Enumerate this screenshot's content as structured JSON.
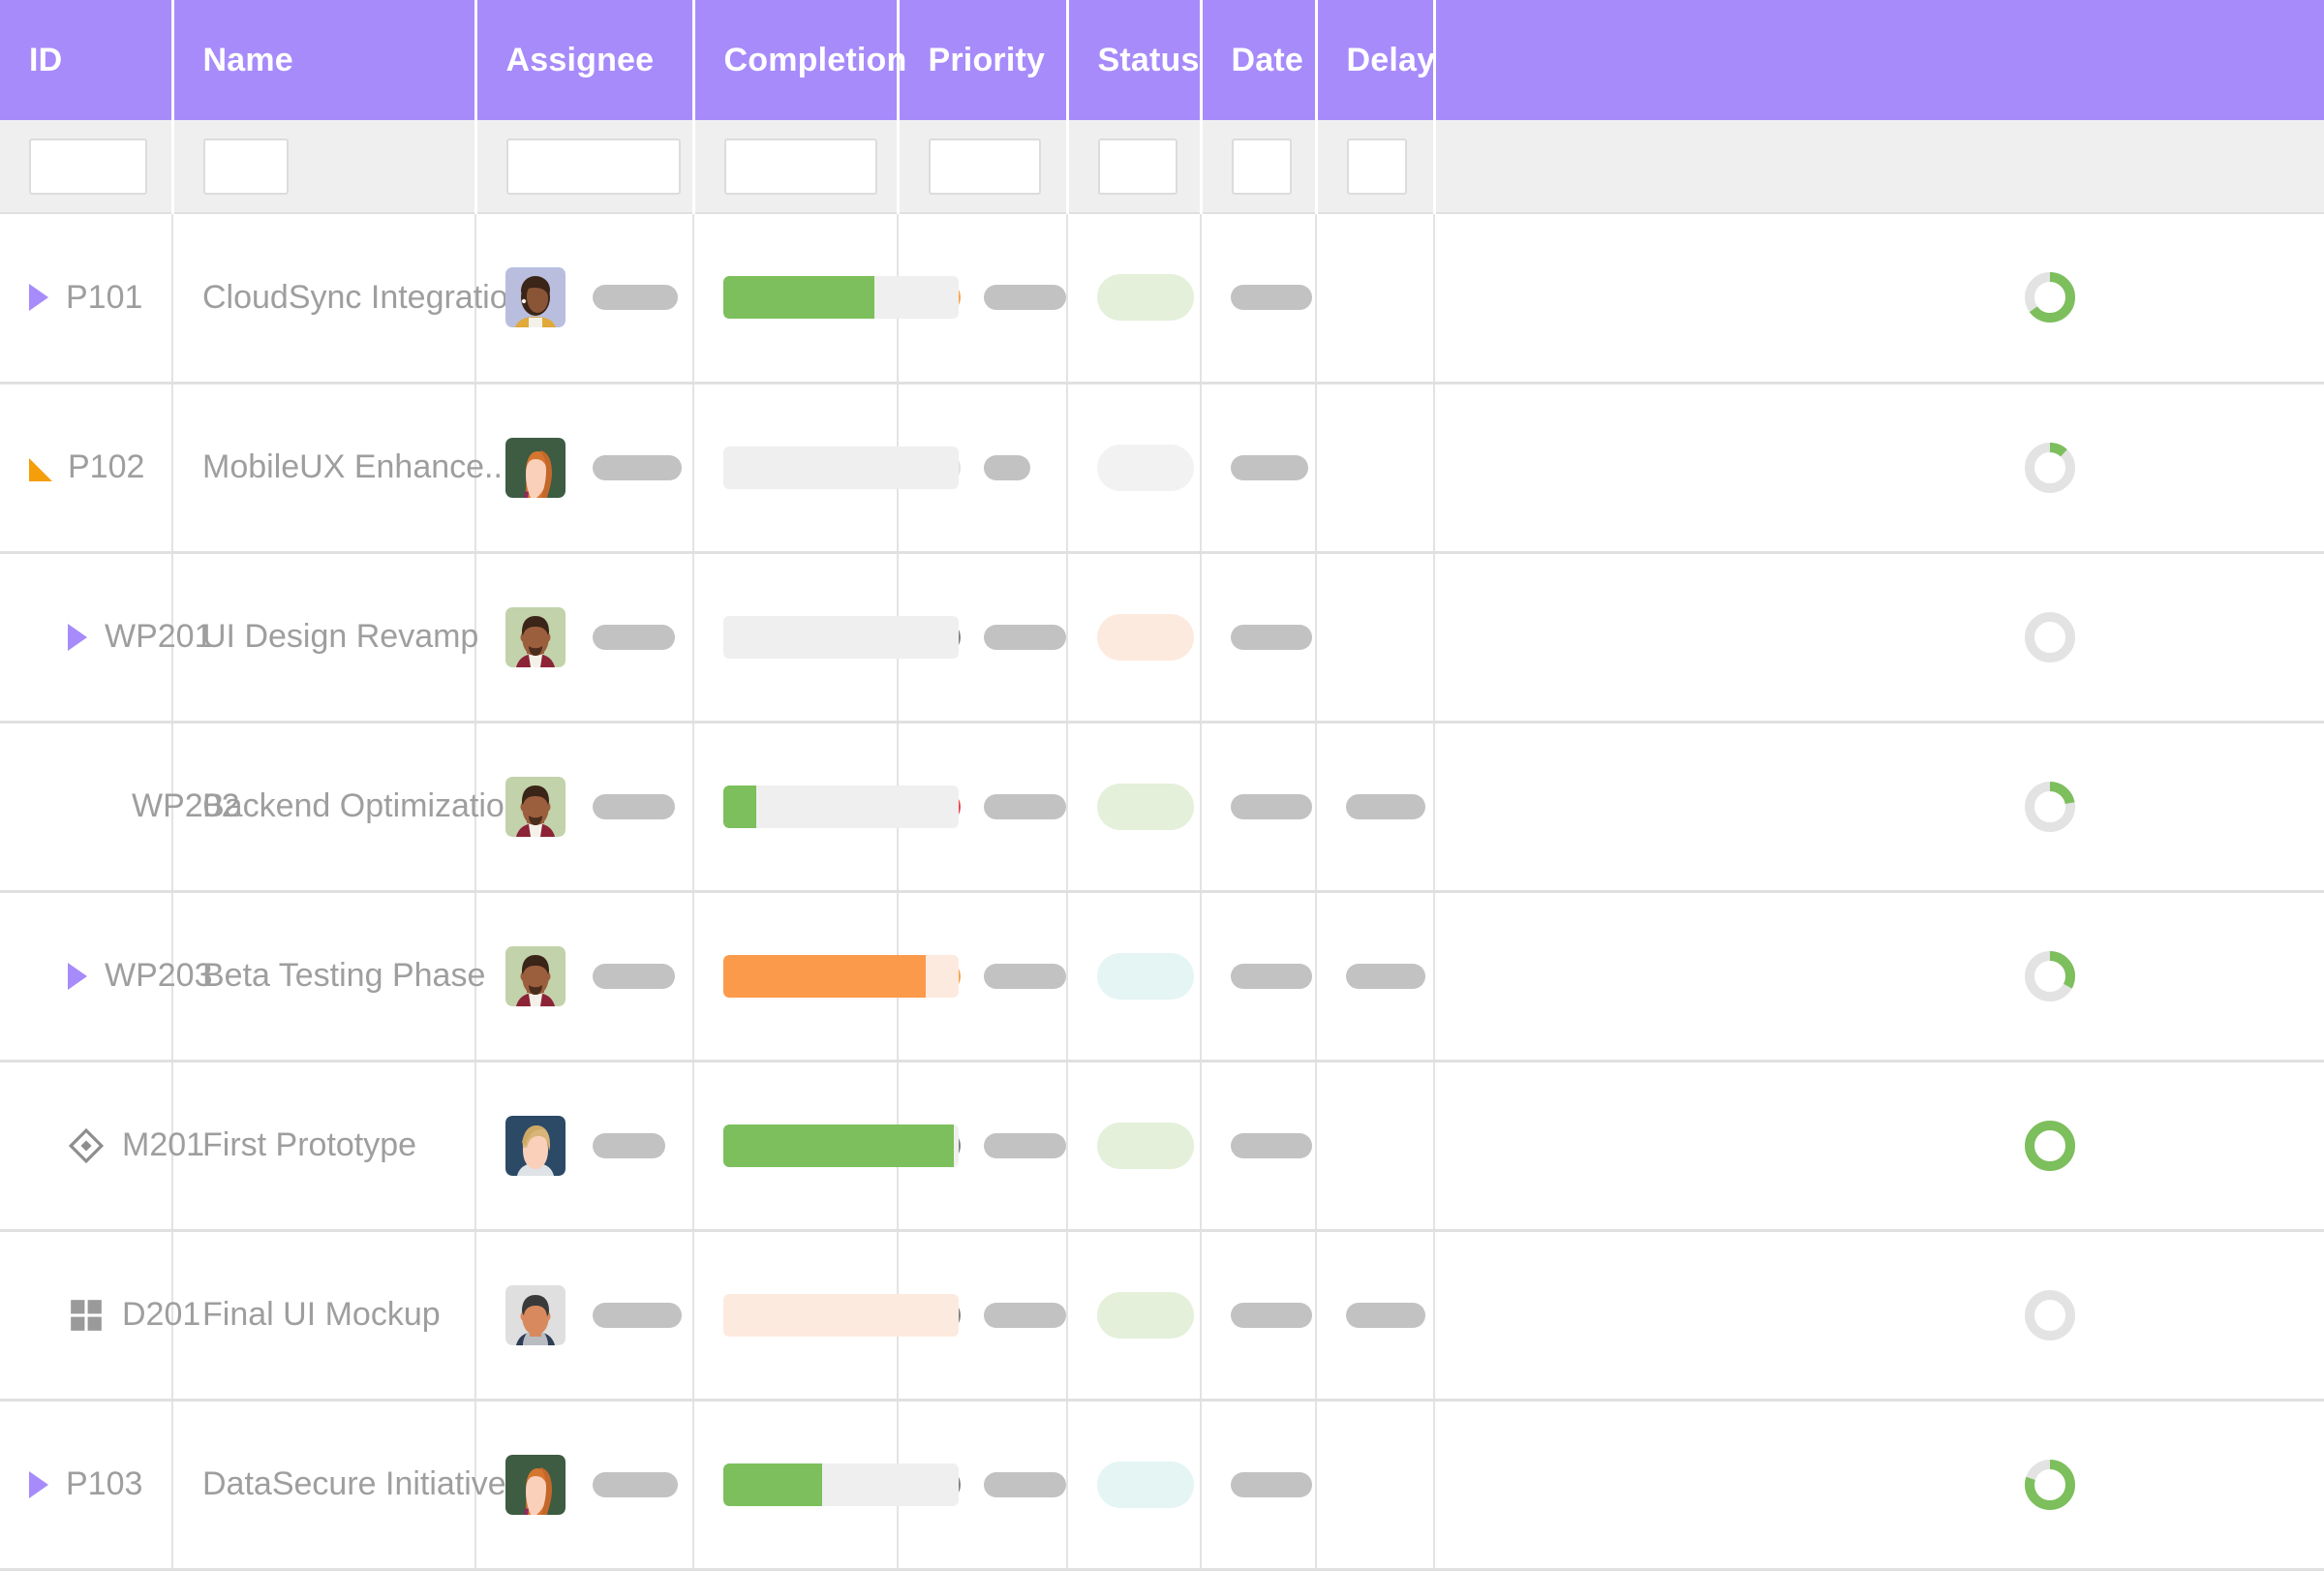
{
  "table": {
    "columns": [
      {
        "key": "id",
        "label": "ID"
      },
      {
        "key": "name",
        "label": "Name"
      },
      {
        "key": "assignee",
        "label": "Assignee"
      },
      {
        "key": "completion",
        "label": "Completion"
      },
      {
        "key": "priority",
        "label": "Priority"
      },
      {
        "key": "status",
        "label": "Status"
      },
      {
        "key": "date",
        "label": "Date"
      },
      {
        "key": "delay",
        "label": "Delay"
      },
      {
        "key": "progress",
        "label": ""
      }
    ],
    "filter_row": {
      "id_value": "",
      "id_placeholder": "",
      "name_value": "",
      "name_placeholder": "",
      "assignee_value": "",
      "assignee_placeholder": "",
      "completion_value": "",
      "completion_placeholder": "",
      "priority_value": "",
      "priority_placeholder": "",
      "status_value": "",
      "status_placeholder": "",
      "date_value": "",
      "date_placeholder": "",
      "delay_value": "",
      "delay_placeholder": ""
    },
    "rows": [
      {
        "id": "P101",
        "name": "CloudSync Integration",
        "indent": 0,
        "toggle": "collapsed-triangle-icon",
        "avatar": "avatar-woman-brown-hair",
        "completion_pct": 64,
        "completion_color": "#7cbf5c",
        "completion_track": "#efefef",
        "priority_color": "#f9a24a",
        "priority_bar_width": 110,
        "status_color": "#e4f0da",
        "status_width": 100,
        "has_date": true,
        "has_delay": false,
        "progress_pct": 65,
        "progress_color": "#7cbf5c"
      },
      {
        "id": "P102",
        "name": "MobileUX Enhance...",
        "indent": 0,
        "toggle": "expanded-triangle-icon",
        "avatar": "avatar-woman-red-hair",
        "completion_pct": 0,
        "completion_color": "#7cbf5c",
        "completion_track": "#efefef",
        "priority_color": "#e0e0e0",
        "priority_bar_width": 48,
        "status_color": "#f2f2f2",
        "status_width": 100,
        "has_date": true,
        "has_delay": false,
        "progress_pct": 12,
        "progress_color": "#7cbf5c"
      },
      {
        "id": "WP201",
        "name": "UI Design Revamp",
        "indent": 1,
        "toggle": "collapsed-triangle-icon",
        "avatar": "avatar-man-beard",
        "completion_pct": 0,
        "completion_color": "#7cbf5c",
        "completion_track": "#efefef",
        "priority_color": "#808080",
        "priority_bar_width": 92,
        "status_color": "#fdeade",
        "status_width": 100,
        "has_date": true,
        "has_delay": false,
        "progress_pct": 0,
        "progress_color": "#7cbf5c"
      },
      {
        "id": "WP202",
        "name": "Backend Optimization",
        "indent": 2,
        "toggle": "none",
        "avatar": "avatar-man-beard",
        "completion_pct": 14,
        "completion_color": "#7cbf5c",
        "completion_track": "#efefef",
        "priority_color": "#e8434a",
        "priority_bar_width": 120,
        "status_color": "#e4f0da",
        "status_width": 100,
        "has_date": true,
        "has_delay": true,
        "progress_pct": 22,
        "progress_color": "#7cbf5c"
      },
      {
        "id": "WP203",
        "name": "Beta Testing Phase",
        "indent": 1,
        "toggle": "collapsed-triangle-icon",
        "avatar": "avatar-man-beard",
        "completion_pct": 86,
        "completion_color": "#fb9a4b",
        "completion_track": "#fdeade",
        "priority_color": "#f9a24a",
        "priority_bar_width": 104,
        "status_color": "#e4f5f3",
        "status_width": 100,
        "has_date": true,
        "has_delay": true,
        "progress_pct": 33,
        "progress_color": "#7cbf5c"
      },
      {
        "id": "M201",
        "name": "First Prototype",
        "indent": 1,
        "toggle": "milestone-diamond-icon",
        "avatar": "avatar-woman-blonde",
        "completion_pct": 98,
        "completion_color": "#7cbf5c",
        "completion_track": "#efefef",
        "priority_color": "#808080",
        "priority_bar_width": 96,
        "status_color": "#e4f0da",
        "status_width": 100,
        "has_date": true,
        "has_delay": false,
        "progress_pct": 100,
        "progress_color": "#7cbf5c"
      },
      {
        "id": "D201",
        "name": "Final UI Mockup",
        "indent": 1,
        "toggle": "deliverable-grid-icon",
        "avatar": "avatar-man-dark-hair",
        "completion_pct": 0,
        "completion_color": "#fb9a4b",
        "completion_track": "#fdeade",
        "priority_color": "#808080",
        "priority_bar_width": 96,
        "status_color": "#e4f0da",
        "status_width": 100,
        "has_date": true,
        "has_delay": true,
        "progress_pct": 0,
        "progress_color": "#7cbf5c"
      },
      {
        "id": "P103",
        "name": "DataSecure Initiative",
        "indent": 0,
        "toggle": "collapsed-triangle-icon",
        "avatar": "avatar-woman-red-hair",
        "completion_pct": 42,
        "completion_color": "#7cbf5c",
        "completion_track": "#efefef",
        "priority_color": "#808080",
        "priority_bar_width": 100,
        "status_color": "#e4f5f3",
        "status_width": 100,
        "has_date": true,
        "has_delay": false,
        "progress_pct": 80,
        "progress_color": "#7cbf5c"
      }
    ]
  },
  "theme": {
    "header_bg": "#a78bfa",
    "header_text": "#ffffff",
    "filter_bg": "#efefef",
    "row_bg": "#ffffff",
    "grid_line": "#e0e0e0",
    "text_muted": "#9e9e9e",
    "skeleton": "#c2c2c2",
    "green": "#7cbf5c",
    "orange": "#fb9a4b",
    "red": "#e8434a",
    "gray": "#808080",
    "ring_track": "#e3e3e3"
  }
}
